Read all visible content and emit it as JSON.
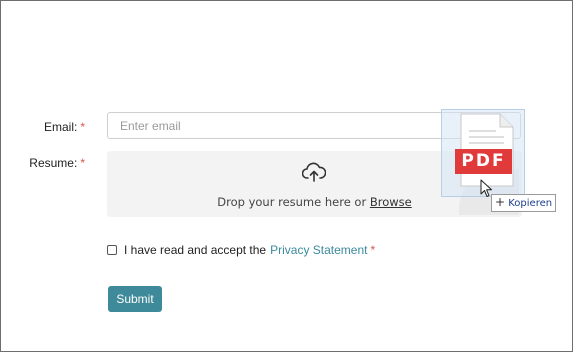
{
  "form": {
    "email_label": "Email:",
    "resume_label": "Resume:",
    "required_mark": "*",
    "email_placeholder": "Enter email",
    "email_value": ""
  },
  "dropzone": {
    "icon": "cloud-upload-icon",
    "text": "Drop your resume here or",
    "browse_label": "Browse"
  },
  "drag": {
    "file_type": "PDF",
    "tooltip_plus": "+",
    "tooltip_label": "Kopieren"
  },
  "consent": {
    "checked": false,
    "text": "I have read and accept the",
    "link_label": "Privacy Statement",
    "required_mark": "*"
  },
  "actions": {
    "submit_label": "Submit"
  },
  "colors": {
    "accent": "#3f8a9a",
    "required": "#d9534f",
    "pdf_badge": "#e03a3a",
    "link": "#3b8a9e"
  }
}
